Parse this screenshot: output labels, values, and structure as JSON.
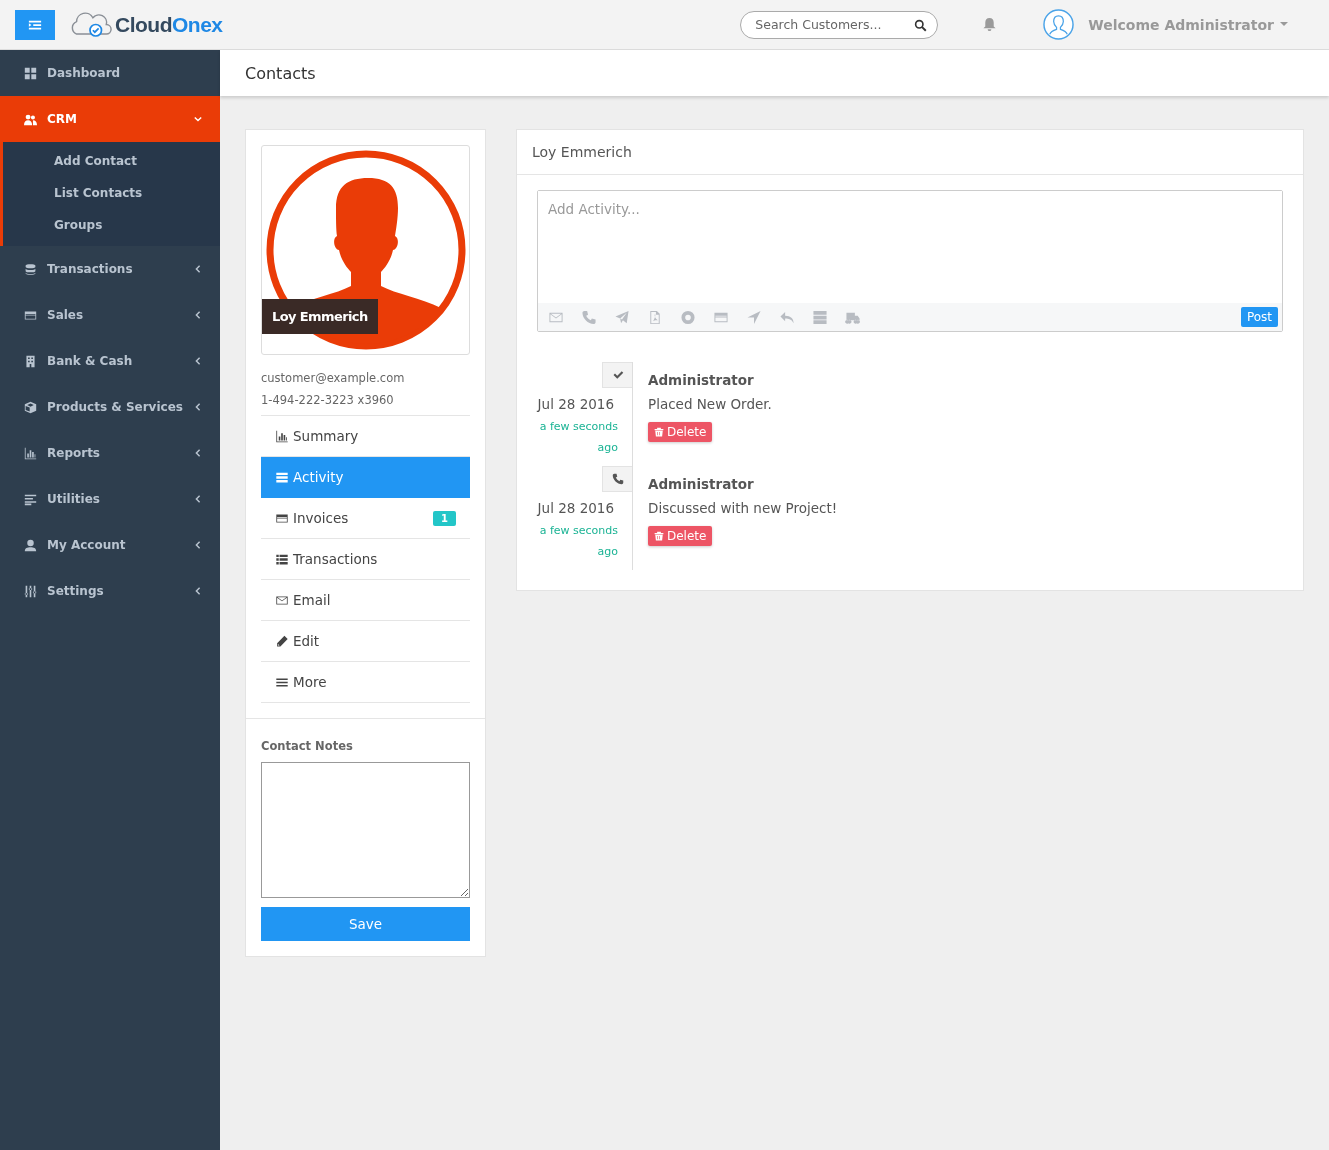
{
  "header": {
    "logo": {
      "text_1": "Cloud",
      "text_2": "Onex"
    },
    "search": {
      "placeholder": "Search Customers..."
    },
    "user": "Welcome Administrator"
  },
  "sidebar": {
    "items": [
      {
        "label": "Dashboard",
        "selected": false
      },
      {
        "label": "CRM",
        "selected": true,
        "expanded": true,
        "children": [
          {
            "label": "Add Contact"
          },
          {
            "label": "List Contacts"
          },
          {
            "label": "Groups"
          }
        ]
      },
      {
        "label": "Transactions",
        "selected": false,
        "expanded": false
      },
      {
        "label": "Sales",
        "selected": false,
        "expanded": false
      },
      {
        "label": "Bank & Cash",
        "selected": false,
        "expanded": false
      },
      {
        "label": "Products & Services",
        "selected": false,
        "expanded": false
      },
      {
        "label": "Reports",
        "selected": false,
        "expanded": false
      },
      {
        "label": "Utilities",
        "selected": false,
        "expanded": false
      },
      {
        "label": "My Account",
        "selected": false,
        "expanded": false
      },
      {
        "label": "Settings",
        "selected": false,
        "expanded": false
      }
    ]
  },
  "page_title": "Contacts",
  "contact": {
    "name_caption": "Loy Emmerich",
    "email": "customer@example.com",
    "phone": "1-494-222-3223 x3960",
    "menu": [
      {
        "label": "Summary",
        "selected": false
      },
      {
        "label": "Activity",
        "selected": true
      },
      {
        "label": "Invoices",
        "selected": false,
        "badge": "1"
      },
      {
        "label": "Transactions",
        "selected": false
      },
      {
        "label": "Email",
        "selected": false
      },
      {
        "label": "Edit",
        "selected": false
      },
      {
        "label": "More",
        "selected": false
      }
    ],
    "notes": {
      "label": "Contact Notes",
      "save": "Save"
    }
  },
  "activity": {
    "title": "Loy Emmerich",
    "input": {
      "placeholder": "Add Activity..."
    },
    "post": "Post",
    "entries": [
      {
        "kind": "check",
        "date": "Jul 28 2016",
        "time": "a few seconds ago",
        "author": "Administrator",
        "text": "Placed New Order.",
        "delete": "Delete"
      },
      {
        "kind": "call",
        "date": "Jul 28 2016",
        "time": "a few seconds ago",
        "author": "Administrator",
        "text": "Discussed with new Project!",
        "delete": "Delete"
      }
    ]
  }
}
